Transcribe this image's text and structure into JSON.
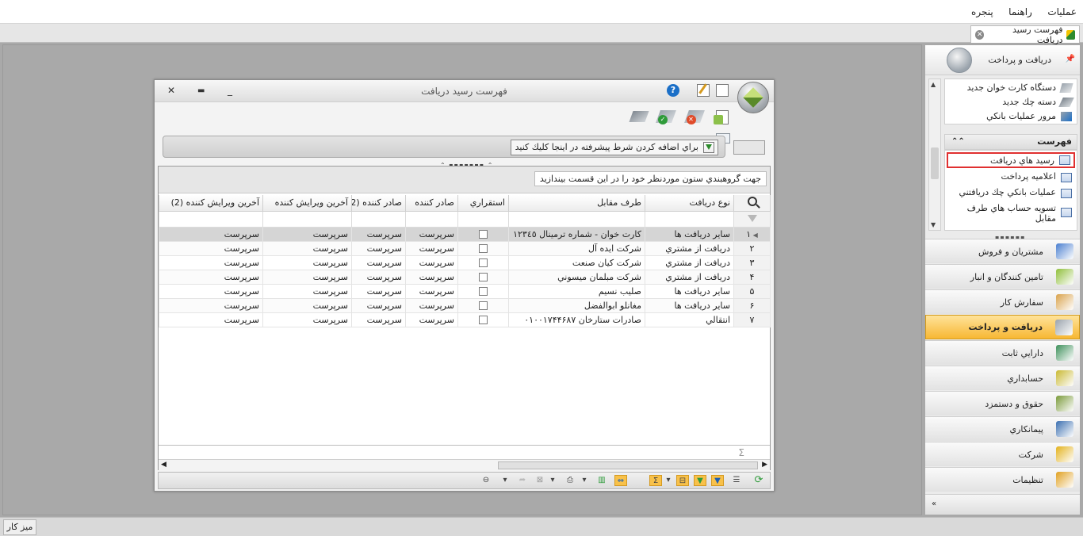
{
  "menu": [
    "عمليات",
    "راهنما",
    "پنجره"
  ],
  "doc_tab": {
    "label": "فهرست رسيد دريافت"
  },
  "statusbar": {
    "desk_label": "ميز كار"
  },
  "sidebar": {
    "header_title": "دريافت و پرداخت",
    "tasks": [
      "دستگاه كارت خوان جديد",
      "دسته چك جديد",
      "مرور عمليات بانكي"
    ],
    "list_title": "فهرست",
    "list_items": [
      "رسيد هاي دريافت",
      "اعلاميه پرداخت",
      "عمليات بانكي چك دريافتني",
      "تسويه حساب هاي طرف مقابل"
    ],
    "selected_item": "رسيد هاي دريافت",
    "modules": [
      {
        "label": "مشتريان و فروش",
        "icon": "sales-chart-icon",
        "color": "#4a7fd0"
      },
      {
        "label": "تامين كنندگان و انبار",
        "icon": "warehouse-boxes-icon",
        "color": "#8fbf3a"
      },
      {
        "label": "سفارش كار",
        "icon": "work-order-icon",
        "color": "#d9a24b"
      },
      {
        "label": "دريافت و پرداخت",
        "icon": "cashier-icon",
        "color": "#9aa3ac",
        "active": true
      },
      {
        "label": "دارايي ثابت",
        "icon": "fixed-asset-icon",
        "color": "#3c8f5a"
      },
      {
        "label": "حسابداري",
        "icon": "accounting-icon",
        "color": "#c9b933"
      },
      {
        "label": "حقوق و دستمزد",
        "icon": "payroll-icon",
        "color": "#7a9a3a"
      },
      {
        "label": "پيمانكاري",
        "icon": "handshake-icon",
        "color": "#3b6fb0"
      },
      {
        "label": "شركت",
        "icon": "company-icon",
        "color": "#e3b21c"
      },
      {
        "label": "تنظيمات",
        "icon": "settings-gear-icon",
        "color": "#e0a020"
      }
    ]
  },
  "window": {
    "title": "فهرست رسيد دريافت",
    "filter_button": "براي اضافه كردن شرط پيشرفته در اينجا كليك كنيد",
    "group_hint": "جهت گروهبندي ستون موردنظر خود را در اين قسمت بيندازيد",
    "columns": [
      "نوع دريافت",
      "طرف مقابل",
      "استقراري",
      "صادر كننده",
      "صادر كننده (2)",
      "آخرين ويرايش  كننده",
      "آخرين ويرايش كننده (2)"
    ],
    "rows": [
      {
        "n": "١",
        "type": "ساير دريافت ها",
        "party": "كارت خوان - شماره ترمينال ١٢٣٤٥",
        "c1": "سرپرست",
        "c2": "سرپرست",
        "c3": "سرپرست",
        "c4": "سرپرست"
      },
      {
        "n": "٢",
        "type": "دريافت از مشتري",
        "party": "شركت ايده آل",
        "c1": "سرپرست",
        "c2": "سرپرست",
        "c3": "سرپرست",
        "c4": "سرپرست"
      },
      {
        "n": "٣",
        "type": "دريافت از مشتري",
        "party": "شركت كيان صنعت",
        "c1": "سرپرست",
        "c2": "سرپرست",
        "c3": "سرپرست",
        "c4": "سرپرست"
      },
      {
        "n": "۴",
        "type": "دريافت از مشتري",
        "party": "شركت مبلمان ميسوني",
        "c1": "سرپرست",
        "c2": "سرپرست",
        "c3": "سرپرست",
        "c4": "سرپرست"
      },
      {
        "n": "۵",
        "type": "ساير دريافت ها",
        "party": "صليب نسيم",
        "c1": "سرپرست",
        "c2": "سرپرست",
        "c3": "سرپرست",
        "c4": "سرپرست"
      },
      {
        "n": "۶",
        "type": "ساير دريافت ها",
        "party": "مغانلو ابوالفضل",
        "c1": "سرپرست",
        "c2": "سرپرست",
        "c3": "سرپرست",
        "c4": "سرپرست"
      },
      {
        "n": "٧",
        "type": "انتقالي",
        "party": "صادرات ستارخان ٠١٠٠١٧۴۴۶٨٧",
        "c1": "سرپرست",
        "c2": "سرپرست",
        "c3": "سرپرست",
        "c4": "سرپرست"
      }
    ]
  }
}
